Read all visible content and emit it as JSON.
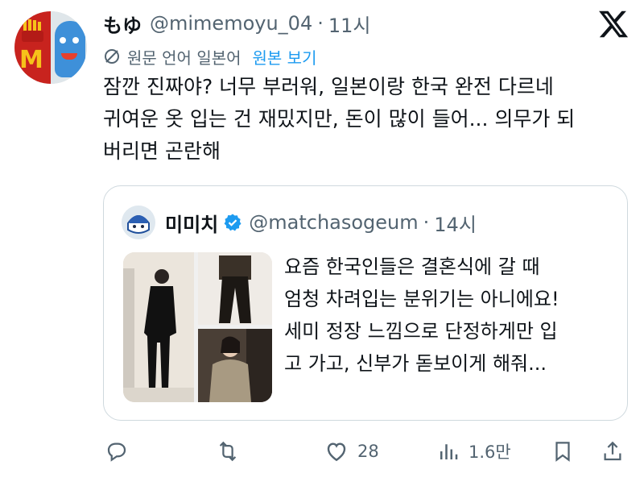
{
  "author": {
    "display_name": "もゆ",
    "handle": "@mimemoyu_04",
    "separator": "·",
    "time": "11시"
  },
  "translation": {
    "language_label": "원문 언어 일본어",
    "show_original_label": "원본 보기"
  },
  "tweet": {
    "lines": [
      "잠깐 진짜야? 너무 부러워, 일본이랑 한국 완전 다르네",
      "귀여운 옷 입는 건 재밌지만, 돈이 많이 들어... 의무가 되",
      "버리면 곤란해"
    ]
  },
  "quote": {
    "display_name": "미미치",
    "handle": "@matchasogeum",
    "separator": "·",
    "time": "14시",
    "lines": [
      "요즘 한국인들은 결혼식에 갈 때",
      "엄청 차려입는 분위기는 아니에요!",
      "세미 정장 느낌으로 단정하게만 입",
      "고 가고, 신부가 돋보이게 해줘..."
    ]
  },
  "actions": {
    "likes": "28",
    "views": "1.6만"
  },
  "icons": {
    "reply": "reply-icon",
    "retweet": "retweet-icon",
    "like": "heart-icon",
    "views": "views-icon",
    "bookmark": "bookmark-icon",
    "share": "share-icon",
    "x_logo": "x-logo-icon",
    "translate": "translate-icon",
    "verified": "verified-badge-icon"
  },
  "colors": {
    "accent": "#1d9bf0",
    "text": "#0f1419",
    "muted": "#536471",
    "border": "#cfd9de"
  }
}
